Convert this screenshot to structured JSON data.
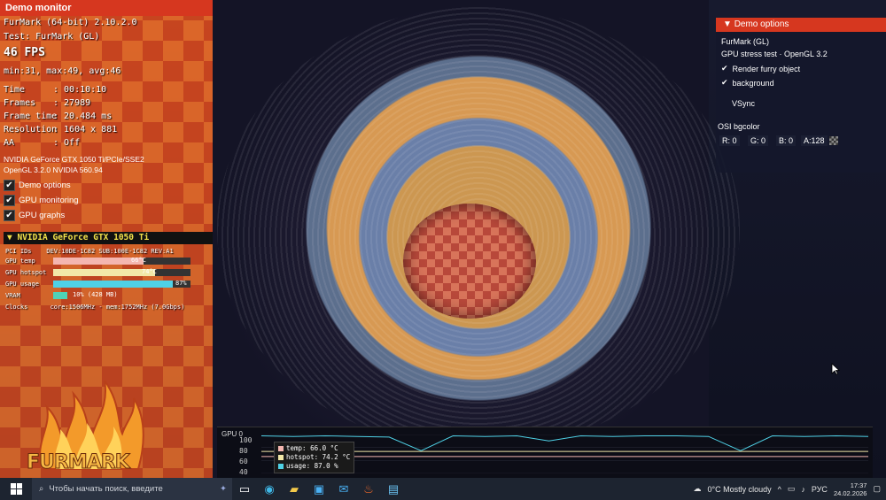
{
  "monitor": {
    "title": "Demo monitor",
    "app_line": "FurMark (64-bit) 2.10.2.0",
    "test_line": "Test: FurMark (GL)",
    "fps": "46 FPS",
    "fps_stats": "min:31, max:49, avg:46",
    "stats": [
      {
        "key": "Time",
        "value": ": 00:10:10"
      },
      {
        "key": "Frames",
        "value": ": 27989"
      },
      {
        "key": "Frame time",
        "value": ": 20.484 ms"
      },
      {
        "key": "Resolution",
        "value": ": 1604 x 881"
      },
      {
        "key": "AA",
        "value": ": Off"
      }
    ],
    "gpu_line": "NVIDIA GeForce GTX 1050 Ti/PCIe/SSE2",
    "gl_line": "OpenGL 3.2.0 NVIDIA 560.94",
    "checkboxes": [
      {
        "label": "Demo options",
        "checked": true
      },
      {
        "label": "GPU monitoring",
        "checked": true
      },
      {
        "label": "GPU graphs",
        "checked": true
      }
    ]
  },
  "gpu": {
    "header": "NVIDIA GeForce GTX 1050 Ti",
    "pci_label": "PCI IDs",
    "pci_value": "DEV:10DE-1C82 SUB:100E-1C82 REV:A1",
    "rows": [
      {
        "label": "GPU temp",
        "value": "66°C",
        "level": 0.66,
        "color": "#f4b6b0"
      },
      {
        "label": "GPU hotspot",
        "value": "74°C",
        "level": 0.74,
        "color": "#f2e8a8"
      },
      {
        "label": "GPU usage",
        "value": "87%",
        "level": 0.87,
        "color": "#4fd1e6"
      },
      {
        "label": "VRAM",
        "value": "10% (428 MB)",
        "level": 0.1,
        "color": "#4fd1b8"
      }
    ],
    "clocks_label": "Clocks",
    "clocks_value": "core:1506MHz - mem:1752MHz (7.0Gbps)"
  },
  "logo_text": "FURMARK",
  "options": {
    "title": "Demo options",
    "line1": "FurMark (GL)",
    "line2": "GPU stress test · OpenGL 3.2",
    "render_furry": "Render furry object",
    "background": "background",
    "vsync": "VSync",
    "osi_label": "OSI bgcolor",
    "r": "R: 0",
    "g": "G: 0",
    "b": "B: 0",
    "a": "A:128"
  },
  "graph": {
    "title": "GPU 0",
    "y_ticks": [
      "100",
      "80",
      "60",
      "40"
    ],
    "legend": [
      {
        "label": "temp: 66.0 °C",
        "color": "#f4b6b0"
      },
      {
        "label": "hotspot: 74.2 °C",
        "color": "#f2e8a8"
      },
      {
        "label": "usage: 87.0 %",
        "color": "#4fd1e6"
      }
    ]
  },
  "chart_data": {
    "type": "line",
    "title": "GPU 0",
    "ylim": [
      40,
      100
    ],
    "series": [
      {
        "name": "temp: 66.0 °C",
        "values": [
          66,
          66,
          66,
          66,
          66,
          66,
          66,
          66,
          66,
          66,
          66,
          66,
          66,
          66,
          66,
          66,
          66,
          66,
          66,
          66
        ]
      },
      {
        "name": "hotspot: 74.2 °C",
        "values": [
          74,
          74,
          74,
          74,
          74,
          74,
          74,
          74,
          74,
          74,
          74,
          74,
          74,
          74,
          74,
          74,
          74,
          74,
          74,
          74
        ]
      },
      {
        "name": "usage: 87.0 %",
        "values": [
          98,
          97,
          98,
          97,
          96,
          75,
          98,
          97,
          98,
          90,
          98,
          97,
          98,
          98,
          97,
          75,
          98,
          97,
          98,
          97
        ]
      }
    ]
  },
  "taskbar": {
    "search_placeholder": "Чтобы начать поиск, введите",
    "weather": "0°C  Mostly cloudy",
    "lang": "РУС",
    "time": "17:37",
    "date": "24.02.2026"
  }
}
